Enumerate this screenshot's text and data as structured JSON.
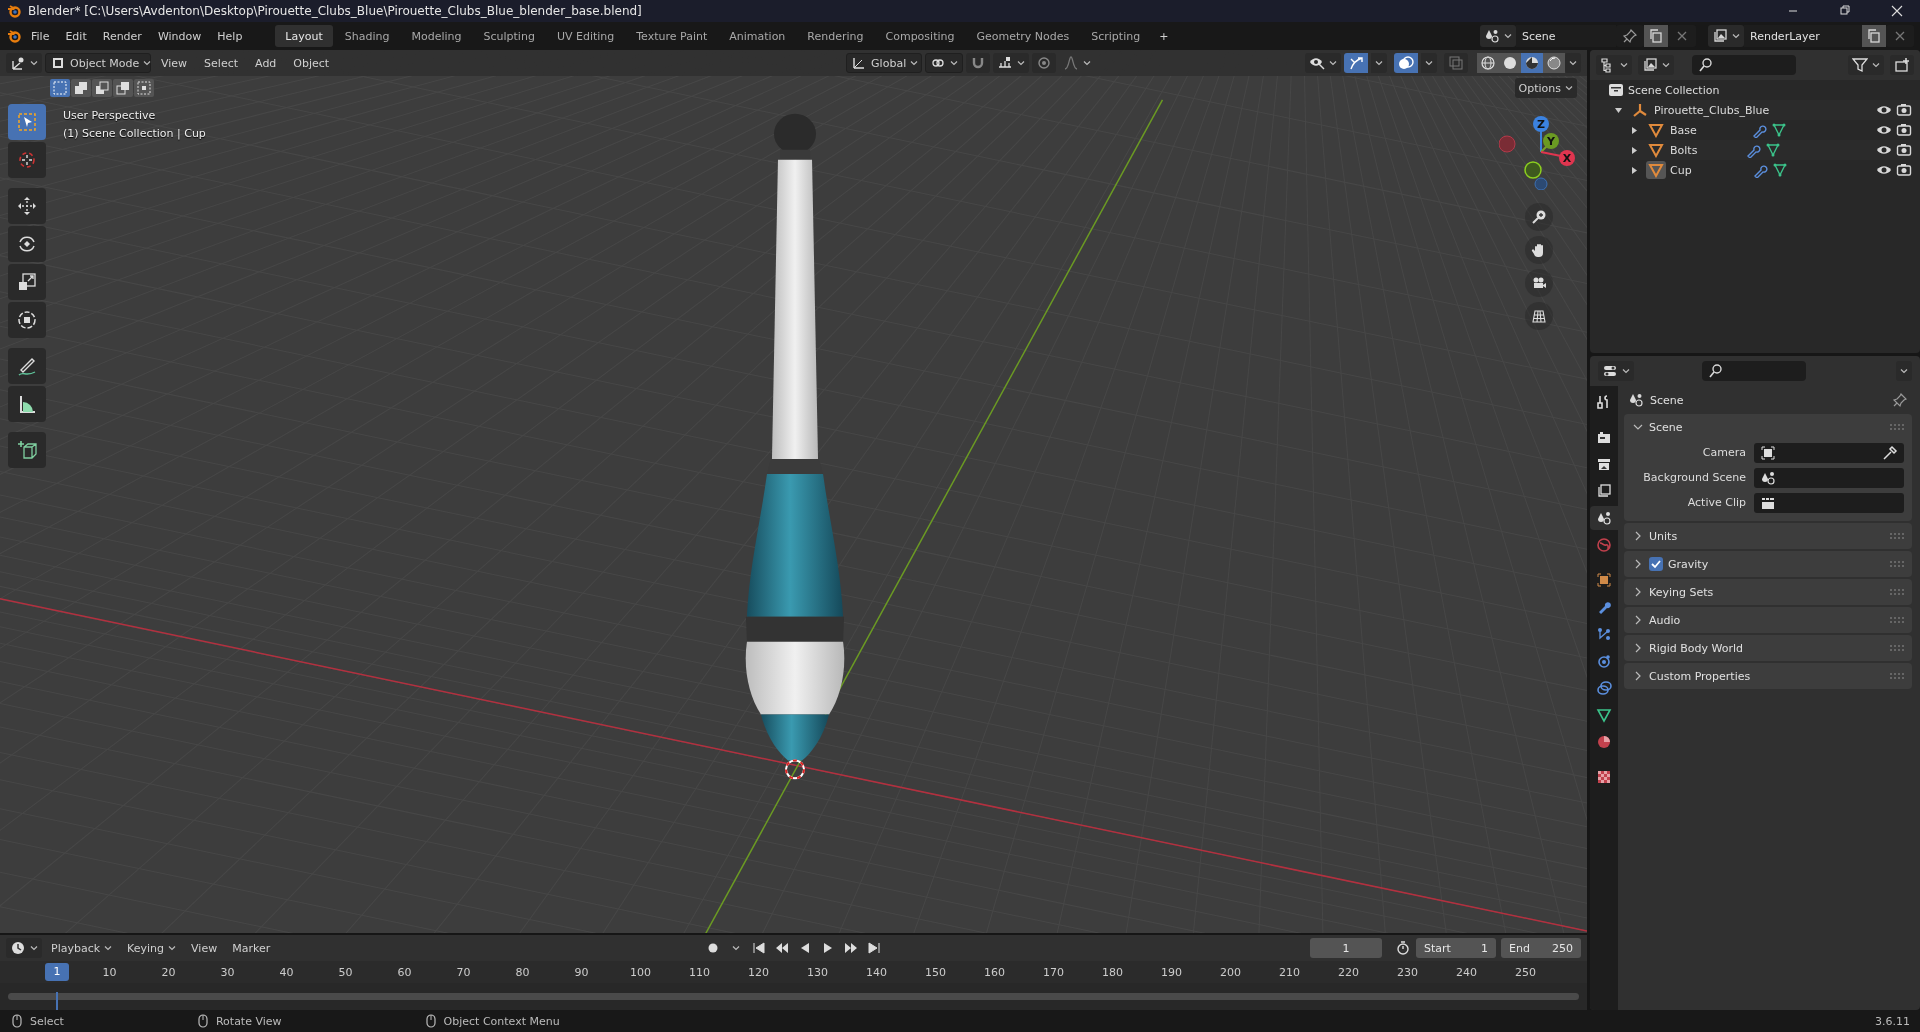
{
  "window": {
    "title": "Blender* [C:\\Users\\Avdenton\\Desktop\\Pirouette_Clubs_Blue\\Pirouette_Clubs_Blue_blender_base.blend]"
  },
  "menu": [
    "File",
    "Edit",
    "Render",
    "Window",
    "Help"
  ],
  "workspaces": [
    {
      "label": "Layout",
      "selected": true
    },
    {
      "label": "Shading",
      "selected": false
    },
    {
      "label": "Modeling",
      "selected": false
    },
    {
      "label": "Sculpting",
      "selected": false
    },
    {
      "label": "UV Editing",
      "selected": false
    },
    {
      "label": "Texture Paint",
      "selected": false
    },
    {
      "label": "Animation",
      "selected": false
    },
    {
      "label": "Rendering",
      "selected": false
    },
    {
      "label": "Compositing",
      "selected": false
    },
    {
      "label": "Geometry Nodes",
      "selected": false
    },
    {
      "label": "Scripting",
      "selected": false
    }
  ],
  "add_workspace": "+",
  "scene": {
    "value": "Scene"
  },
  "view_layer": {
    "value": "RenderLayer"
  },
  "viewport": {
    "mode": "Object Mode",
    "menus": [
      "View",
      "Select",
      "Add",
      "Object"
    ],
    "orientation": "Global",
    "options": "Options",
    "info": [
      "User Perspective",
      "(1) Scene Collection | Cup"
    ],
    "select_modes": [
      {
        "kind": "set",
        "selected": true
      },
      {
        "kind": "extend",
        "selected": false
      },
      {
        "kind": "subtract",
        "selected": false
      },
      {
        "kind": "difference",
        "selected": false
      },
      {
        "kind": "intersect",
        "selected": false
      }
    ],
    "tools": [
      {
        "kind": "select-box",
        "selected": true
      },
      {
        "kind": "cursor",
        "selected": false
      },
      {
        "kind": "move",
        "selected": false
      },
      {
        "kind": "rotate",
        "selected": false
      },
      {
        "kind": "scale",
        "selected": false
      },
      {
        "kind": "transform",
        "selected": false
      },
      {
        "kind": "annotate",
        "selected": false
      },
      {
        "kind": "measure",
        "selected": false
      },
      {
        "kind": "add-cube",
        "selected": false
      }
    ],
    "shading": [
      {
        "kind": "wireframe",
        "selected": false
      },
      {
        "kind": "solid",
        "selected": false
      },
      {
        "kind": "material",
        "selected": true
      },
      {
        "kind": "rendered",
        "selected": false
      }
    ],
    "gizmo": {
      "x": "X",
      "y": "Y",
      "z": "Z"
    },
    "gizmos_toggle": {
      "on": true
    },
    "overlays_toggle": {
      "on": true
    },
    "xray_toggle": {
      "on": false
    }
  },
  "outliner": {
    "root": "Scene Collection",
    "items": [
      {
        "name": "Pirouette_Clubs_Blue",
        "kind": "empty",
        "expanded": true,
        "selected": false,
        "children": [
          {
            "name": "Base",
            "kind": "mesh",
            "expanded": false,
            "selected": false
          },
          {
            "name": "Bolts",
            "kind": "mesh",
            "expanded": false,
            "selected": false
          },
          {
            "name": "Cup",
            "kind": "mesh",
            "expanded": false,
            "selected": true
          }
        ]
      }
    ]
  },
  "properties": {
    "tabs": [
      {
        "kind": "tool",
        "selected": false
      },
      {
        "kind": "render",
        "selected": false
      },
      {
        "kind": "output",
        "selected": false
      },
      {
        "kind": "view-layer",
        "selected": false
      },
      {
        "kind": "scene",
        "selected": true
      },
      {
        "kind": "world",
        "selected": false
      },
      {
        "kind": "object",
        "selected": false
      },
      {
        "kind": "modifier",
        "selected": false
      },
      {
        "kind": "particles",
        "selected": false
      },
      {
        "kind": "physics",
        "selected": false
      },
      {
        "kind": "constraint",
        "selected": false
      },
      {
        "kind": "data",
        "selected": false
      },
      {
        "kind": "material",
        "selected": false
      },
      {
        "kind": "texture",
        "selected": false
      }
    ],
    "context": "Scene",
    "panels": [
      {
        "title": "Scene",
        "kind": "plain",
        "expanded": true,
        "fields": [
          {
            "label": "Camera",
            "kind": "camera"
          },
          {
            "label": "Background Scene",
            "kind": "scene"
          },
          {
            "label": "Active Clip",
            "kind": "clip"
          }
        ]
      },
      {
        "title": "Units",
        "kind": "plain",
        "expanded": false
      },
      {
        "title": "Gravity",
        "kind": "toggle",
        "expanded": false,
        "checked": true
      },
      {
        "title": "Keying Sets",
        "kind": "plain",
        "expanded": false
      },
      {
        "title": "Audio",
        "kind": "plain",
        "expanded": false
      },
      {
        "title": "Rigid Body World",
        "kind": "plain",
        "expanded": false
      },
      {
        "title": "Custom Properties",
        "kind": "plain",
        "expanded": false
      }
    ]
  },
  "timeline": {
    "menus": [
      "Playback",
      "Keying",
      "View",
      "Marker"
    ],
    "current_frame": "1",
    "start_label": "Start",
    "start": "1",
    "end_label": "End",
    "end": "250",
    "ruler": [
      {
        "label": "1",
        "selected": true
      },
      {
        "label": "10",
        "selected": false
      },
      {
        "label": "20",
        "selected": false
      },
      {
        "label": "30",
        "selected": false
      },
      {
        "label": "40",
        "selected": false
      },
      {
        "label": "50",
        "selected": false
      },
      {
        "label": "60",
        "selected": false
      },
      {
        "label": "70",
        "selected": false
      },
      {
        "label": "80",
        "selected": false
      },
      {
        "label": "90",
        "selected": false
      },
      {
        "label": "100",
        "selected": false
      },
      {
        "label": "110",
        "selected": false
      },
      {
        "label": "120",
        "selected": false
      },
      {
        "label": "130",
        "selected": false
      },
      {
        "label": "140",
        "selected": false
      },
      {
        "label": "150",
        "selected": false
      },
      {
        "label": "160",
        "selected": false
      },
      {
        "label": "170",
        "selected": false
      },
      {
        "label": "180",
        "selected": false
      },
      {
        "label": "190",
        "selected": false
      },
      {
        "label": "200",
        "selected": false
      },
      {
        "label": "210",
        "selected": false
      },
      {
        "label": "220",
        "selected": false
      },
      {
        "label": "230",
        "selected": false
      },
      {
        "label": "240",
        "selected": false
      },
      {
        "label": "250",
        "selected": false
      }
    ]
  },
  "status_bar": {
    "hints": [
      "Select",
      "Rotate View",
      "Object Context Menu"
    ],
    "version": "3.6.11"
  }
}
